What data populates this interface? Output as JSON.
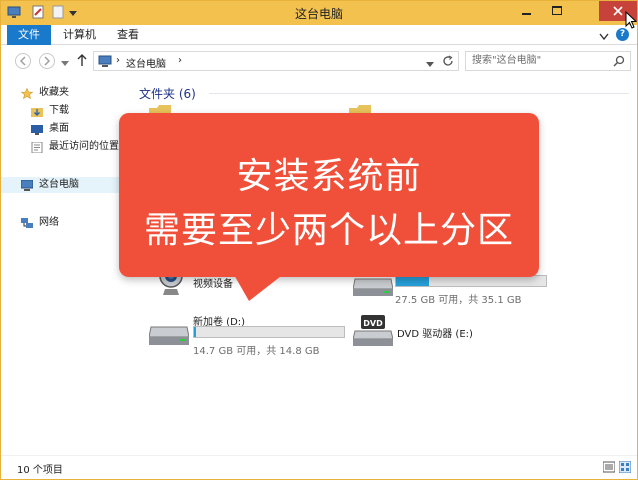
{
  "window": {
    "title": "这台电脑"
  },
  "tabs": [
    {
      "label": "文件"
    },
    {
      "label": "计算机"
    },
    {
      "label": "查看"
    }
  ],
  "navigation": {
    "address_segments": [
      "这台电脑"
    ],
    "search_placeholder": "搜索\"这台电脑\""
  },
  "sidebar": {
    "favorites": {
      "label": "收藏夹",
      "items": [
        {
          "label": "下载"
        },
        {
          "label": "桌面"
        },
        {
          "label": "最近访问的位置"
        }
      ]
    },
    "this_pc": {
      "label": "这台电脑"
    },
    "network": {
      "label": "网络"
    }
  },
  "content": {
    "folders_group": {
      "label": "文件夹 (6)"
    },
    "devices": [
      {
        "name": "视频设备"
      },
      {
        "name": "",
        "info": "27.5 GB 可用，共 35.1 GB",
        "used_fraction": 0.22
      },
      {
        "name": "新加卷 (D:)",
        "info": "14.7 GB 可用，共 14.8 GB",
        "used_fraction": 0.01
      },
      {
        "name": "DVD 驱动器 (E:)"
      }
    ]
  },
  "statusbar": {
    "item_count": "10 个项目"
  },
  "overlay": {
    "line1": "安装系统前",
    "line2": "需要至少两个以上分区"
  },
  "colors": {
    "titlebar": "#f2c14e",
    "ribbon_file": "#1979ca",
    "close_button": "#c7423a",
    "callout": "#f0503a",
    "storage_bar": "#26a0da"
  }
}
